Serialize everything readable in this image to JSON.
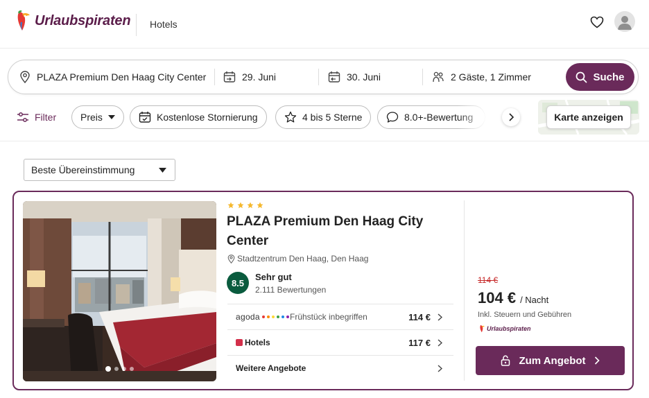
{
  "header": {
    "brand": "Urlaubspiraten",
    "nav_item": "Hotels",
    "icons": {
      "favorites": "heart-icon",
      "account": "user-avatar-icon"
    }
  },
  "search": {
    "destination": "PLAZA Premium Den Haag City Center",
    "checkin": "29. Juni",
    "checkout": "30. Juni",
    "guests": "2 Gäste, 1 Zimmer",
    "button_label": "Suche"
  },
  "filters": {
    "filter_label": "Filter",
    "chips": [
      {
        "label": "Preis",
        "icon": "caret-down-icon"
      },
      {
        "label": "Kostenlose Stornierung",
        "icon": "calendar-check-icon"
      },
      {
        "label": "4 bis 5 Sterne",
        "icon": "star-icon"
      },
      {
        "label": "8.0+-Bewertung",
        "icon": "chat-bubble-icon"
      }
    ],
    "map_button": "Karte anzeigen"
  },
  "sort": {
    "selected": "Beste Übereinstimmung"
  },
  "result": {
    "stars": 4,
    "name": "PLAZA Premium Den Haag City Center",
    "location": "Stadtzentrum Den Haag, Den Haag",
    "rating": {
      "score": "8.5",
      "label": "Sehr gut",
      "count": "2.111 Bewertungen"
    },
    "offers": [
      {
        "provider": "agoda",
        "info": "Frühstück inbegriffen",
        "price": "114 €"
      },
      {
        "provider": "Hotels",
        "info": "",
        "price": "117 €"
      }
    ],
    "more_offers": "Weitere Angebote",
    "old_price": "114 €",
    "price": "104 €",
    "per_night": "/ Nacht",
    "tax_note": "Inkl. Steuern und Gebühren",
    "vendor": "Urlaubspiraten",
    "deal_button": "Zum Angebot",
    "carousel": {
      "total": 4,
      "active": 1
    }
  },
  "colors": {
    "brand": "#6a2a5a",
    "rating_badge": "#0a5b3e",
    "old_price": "#c62828",
    "star": "#f5b82e"
  }
}
